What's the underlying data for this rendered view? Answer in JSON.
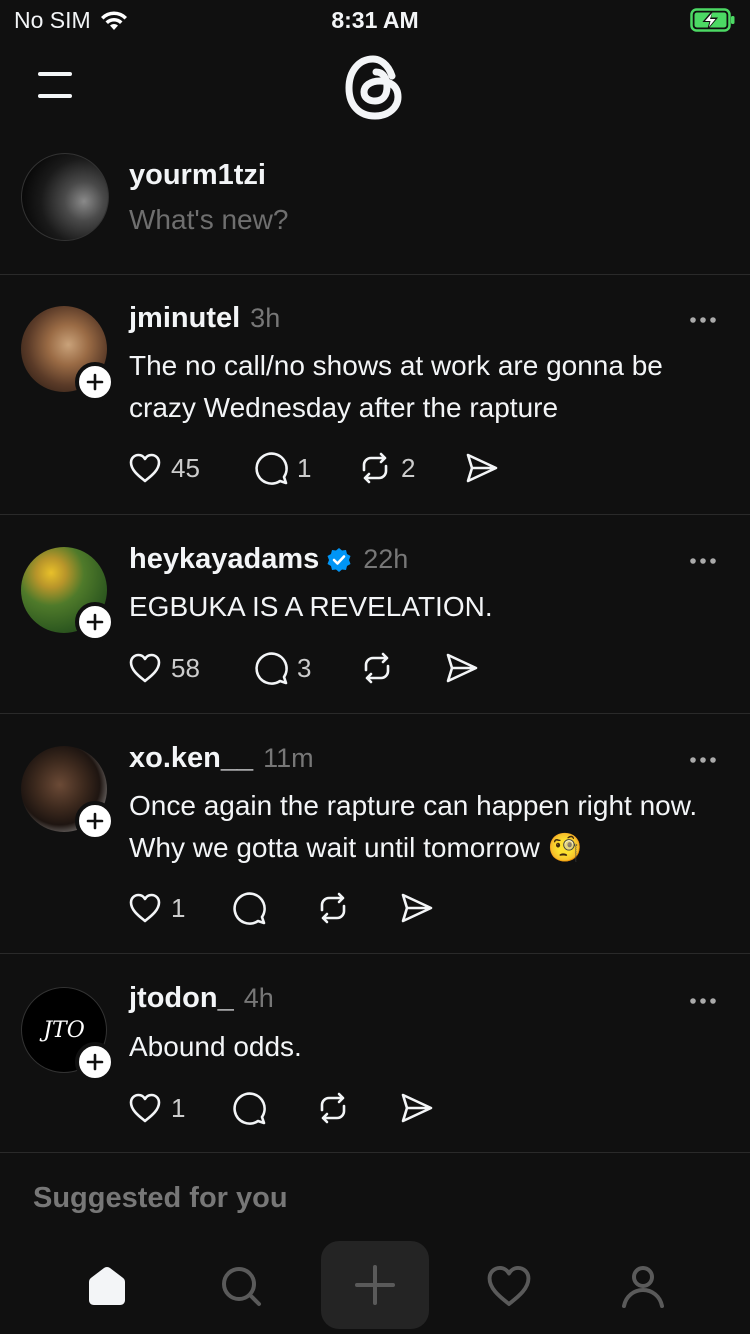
{
  "status_bar": {
    "carrier": "No SIM",
    "time": "8:31 AM",
    "battery_color": "#4cd964"
  },
  "top_nav": {
    "logo": "threads-logo-icon",
    "menu": "menu-icon"
  },
  "composer": {
    "username": "yourm1tzi",
    "placeholder": "What's new?"
  },
  "posts": [
    {
      "username": "jminutel",
      "time": "3h",
      "verified": false,
      "text": "The no call/no shows at work are gonna be crazy Wednesday after the rapture",
      "likes": "45",
      "replies": "1",
      "reposts": "2"
    },
    {
      "username": "heykayadams",
      "time": "22h",
      "verified": true,
      "text": "EGBUKA IS A REVELATION.",
      "likes": "58",
      "replies": "3",
      "reposts": ""
    },
    {
      "username": "xo.ken__",
      "time": "11m",
      "verified": false,
      "text": "Once again the rapture can happen right now. Why we gotta wait until tomorrow 🧐",
      "likes": "1",
      "replies": "",
      "reposts": ""
    },
    {
      "username": "jtodon_",
      "time": "4h",
      "verified": false,
      "text": "Abound odds.",
      "likes": "1",
      "replies": "",
      "reposts": "",
      "avatar_text": "JTO"
    }
  ],
  "suggested_label": "Suggested for you",
  "bottom_nav": {
    "tabs": [
      "home-icon",
      "search-icon",
      "create-icon",
      "activity-icon",
      "profile-icon"
    ],
    "active": "home-icon"
  },
  "colors": {
    "background": "#101010",
    "text": "#f3f5f7",
    "muted": "#777777",
    "verified": "#0095f6",
    "divider": "#2a2a2a"
  }
}
